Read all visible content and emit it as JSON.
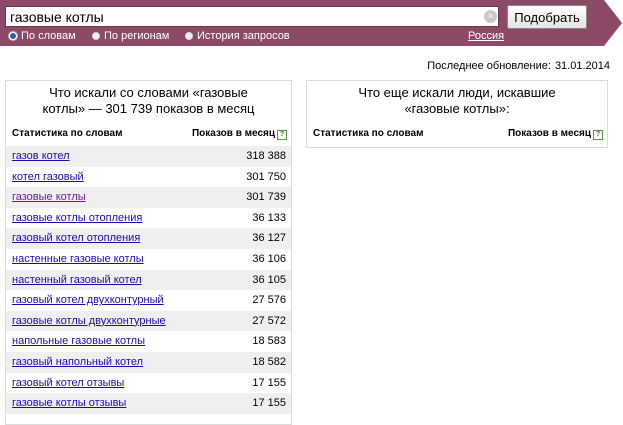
{
  "search": {
    "query": "газовые котлы",
    "submit_label": "Подобрать",
    "clear_glyph": "×"
  },
  "modes": [
    {
      "label": "По словам",
      "selected": true
    },
    {
      "label": "По регионам",
      "selected": false
    },
    {
      "label": "История запросов",
      "selected": false
    }
  ],
  "region": "Россия",
  "updated": {
    "label": "Последнее обновление:",
    "date": "31.01.2014"
  },
  "left_panel": {
    "title": "Что искали со словами «газовые котлы» — 301 739 показов в месяц",
    "col_word": "Статистика по словам",
    "col_count": "Показов в месяц",
    "help_glyph": "?",
    "rows": [
      {
        "phrase": "газов котел",
        "count": "318 388"
      },
      {
        "phrase": "котел газовый",
        "count": "301 750"
      },
      {
        "phrase": "газовые котлы",
        "count": "301 739"
      },
      {
        "phrase": "газовые котлы отопления",
        "count": "36 133"
      },
      {
        "phrase": "газовый котел отопления",
        "count": "36 127"
      },
      {
        "phrase": "настенные газовые котлы",
        "count": "36 106"
      },
      {
        "phrase": "настенный газовый котел",
        "count": "36 105"
      },
      {
        "phrase": "газовый котел двухконтурный",
        "count": "27 576"
      },
      {
        "phrase": "газовые котлы двухконтурные",
        "count": "27 572"
      },
      {
        "phrase": "напольные газовые котлы",
        "count": "18 583"
      },
      {
        "phrase": "газовый напольный котел",
        "count": "18 582"
      },
      {
        "phrase": "газовый котел отзывы",
        "count": "17 155"
      },
      {
        "phrase": "газовые котлы отзывы",
        "count": "17 155"
      }
    ]
  },
  "right_panel": {
    "title": "Что еще искали люди, искавшие «газовые котлы»:",
    "col_word": "Статистика по словам",
    "col_count": "Показов в месяц",
    "help_glyph": "?"
  },
  "colors": {
    "header": "#8c4a68",
    "link": "#1a0dab",
    "visited_link": "#6b1e96"
  }
}
